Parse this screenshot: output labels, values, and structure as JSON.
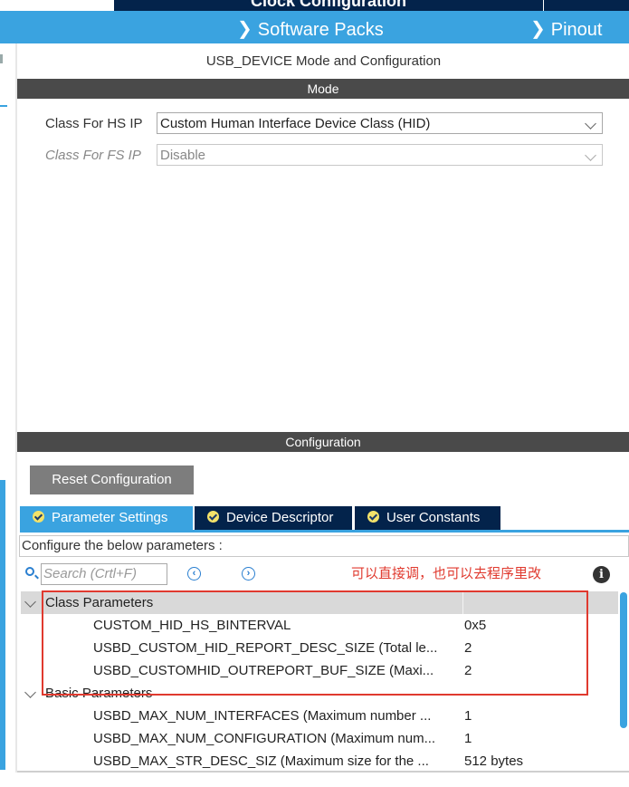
{
  "header": {
    "top_title": "Clock Configuration",
    "software_packs_label": "Software Packs",
    "pinout_label": "Pinout",
    "chevron_icon": "chevron-down-icon"
  },
  "mode": {
    "title": "USB_DEVICE Mode and Configuration",
    "section_label": "Mode",
    "hs_label": "Class For HS IP",
    "hs_value": "Custom Human Interface Device Class (HID)",
    "fs_label": "Class For FS IP",
    "fs_value": "Disable"
  },
  "configuration": {
    "section_label": "Configuration",
    "reset_label": "Reset Configuration",
    "tabs": [
      {
        "label": "Parameter Settings",
        "active": true
      },
      {
        "label": "Device Descriptor",
        "active": false
      },
      {
        "label": "User Constants",
        "active": false
      }
    ],
    "configure_text": "Configure the below parameters :",
    "search_placeholder": "Search (Crtl+F)",
    "annotation": "可以直接调，也可以去程序里改"
  },
  "tree": {
    "groups": [
      {
        "name": "Class Parameters",
        "params": [
          {
            "name": "CUSTOM_HID_HS_BINTERVAL",
            "value": "0x5"
          },
          {
            "name": "USBD_CUSTOM_HID_REPORT_DESC_SIZE (Total le...",
            "value": "2"
          },
          {
            "name": "USBD_CUSTOMHID_OUTREPORT_BUF_SIZE (Maxi...",
            "value": "2"
          }
        ]
      },
      {
        "name": "Basic Parameters",
        "params": [
          {
            "name": "USBD_MAX_NUM_INTERFACES (Maximum number ...",
            "value": "1"
          },
          {
            "name": "USBD_MAX_NUM_CONFIGURATION (Maximum num...",
            "value": "1"
          },
          {
            "name": "USBD_MAX_STR_DESC_SIZ (Maximum size for the ...",
            "value": "512 bytes"
          }
        ]
      }
    ]
  },
  "colors": {
    "accent_blue": "#3aa3e0",
    "navy": "#03234b",
    "annotation_red": "#e03a2f"
  }
}
